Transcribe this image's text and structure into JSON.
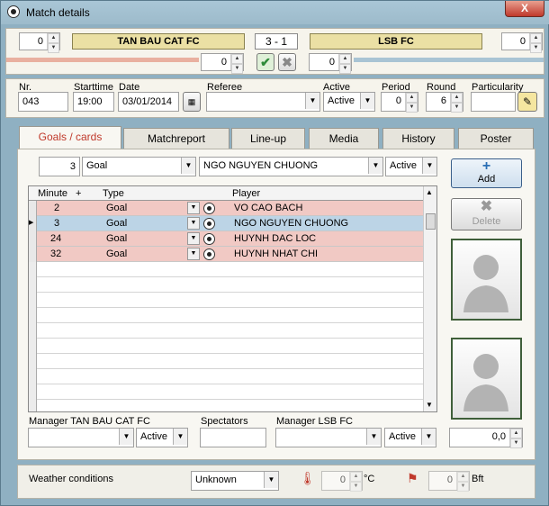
{
  "window": {
    "title": "Match details",
    "close_label": "X"
  },
  "match": {
    "home_score_left": "0",
    "home_team": "TAN BAU CAT FC",
    "score": "3 - 1",
    "away_team": "LSB FC",
    "away_score_right": "0",
    "home_extra": "0",
    "away_extra": "0"
  },
  "info": {
    "nr_label": "Nr.",
    "nr_value": "043",
    "starttime_label": "Starttime",
    "starttime_value": "19:00",
    "date_label": "Date",
    "date_value": "03/01/2014",
    "referee_label": "Referee",
    "referee_value": "",
    "active_label": "Active",
    "active_value": "Active",
    "period_label": "Period",
    "period_value": "0",
    "round_label": "Round",
    "round_value": "6",
    "particularity_label": "Particularity",
    "particularity_value": ""
  },
  "tabs": [
    "Goals / cards",
    "Matchreport",
    "Line-up",
    "Media",
    "History",
    "Poster"
  ],
  "goal_entry": {
    "minute": "3",
    "type": "Goal",
    "player": "NGO NGUYEN CHUONG",
    "status": "Active"
  },
  "table": {
    "headers": {
      "minute": "Minute",
      "plus": "+",
      "type": "Type",
      "player": "Player"
    },
    "rows": [
      {
        "minute": "2",
        "type": "Goal",
        "player": "VO CAO BACH"
      },
      {
        "minute": "3",
        "type": "Goal",
        "player": "NGO NGUYEN CHUONG"
      },
      {
        "minute": "24",
        "type": "Goal",
        "player": "HUYNH DAC LOC"
      },
      {
        "minute": "32",
        "type": "Goal",
        "player": "HUYNH NHAT CHI"
      }
    ]
  },
  "buttons": {
    "add": "Add",
    "delete": "Delete"
  },
  "managers": {
    "home_label": "Manager TAN BAU CAT FC",
    "home_status": "Active",
    "spectators_label": "Spectators",
    "spectators_value": "",
    "away_label": "Manager LSB FC",
    "away_status": "Active",
    "rating_value": "0,0"
  },
  "weather": {
    "label": "Weather conditions",
    "value": "Unknown",
    "temp_value": "0",
    "temp_unit": "°C",
    "wind_value": "0",
    "wind_unit": "Bft"
  },
  "colors": {
    "goal_row": "#f1c9c4",
    "selected_row": "#bcd4e6",
    "team_bar": "#ebe0a4"
  }
}
